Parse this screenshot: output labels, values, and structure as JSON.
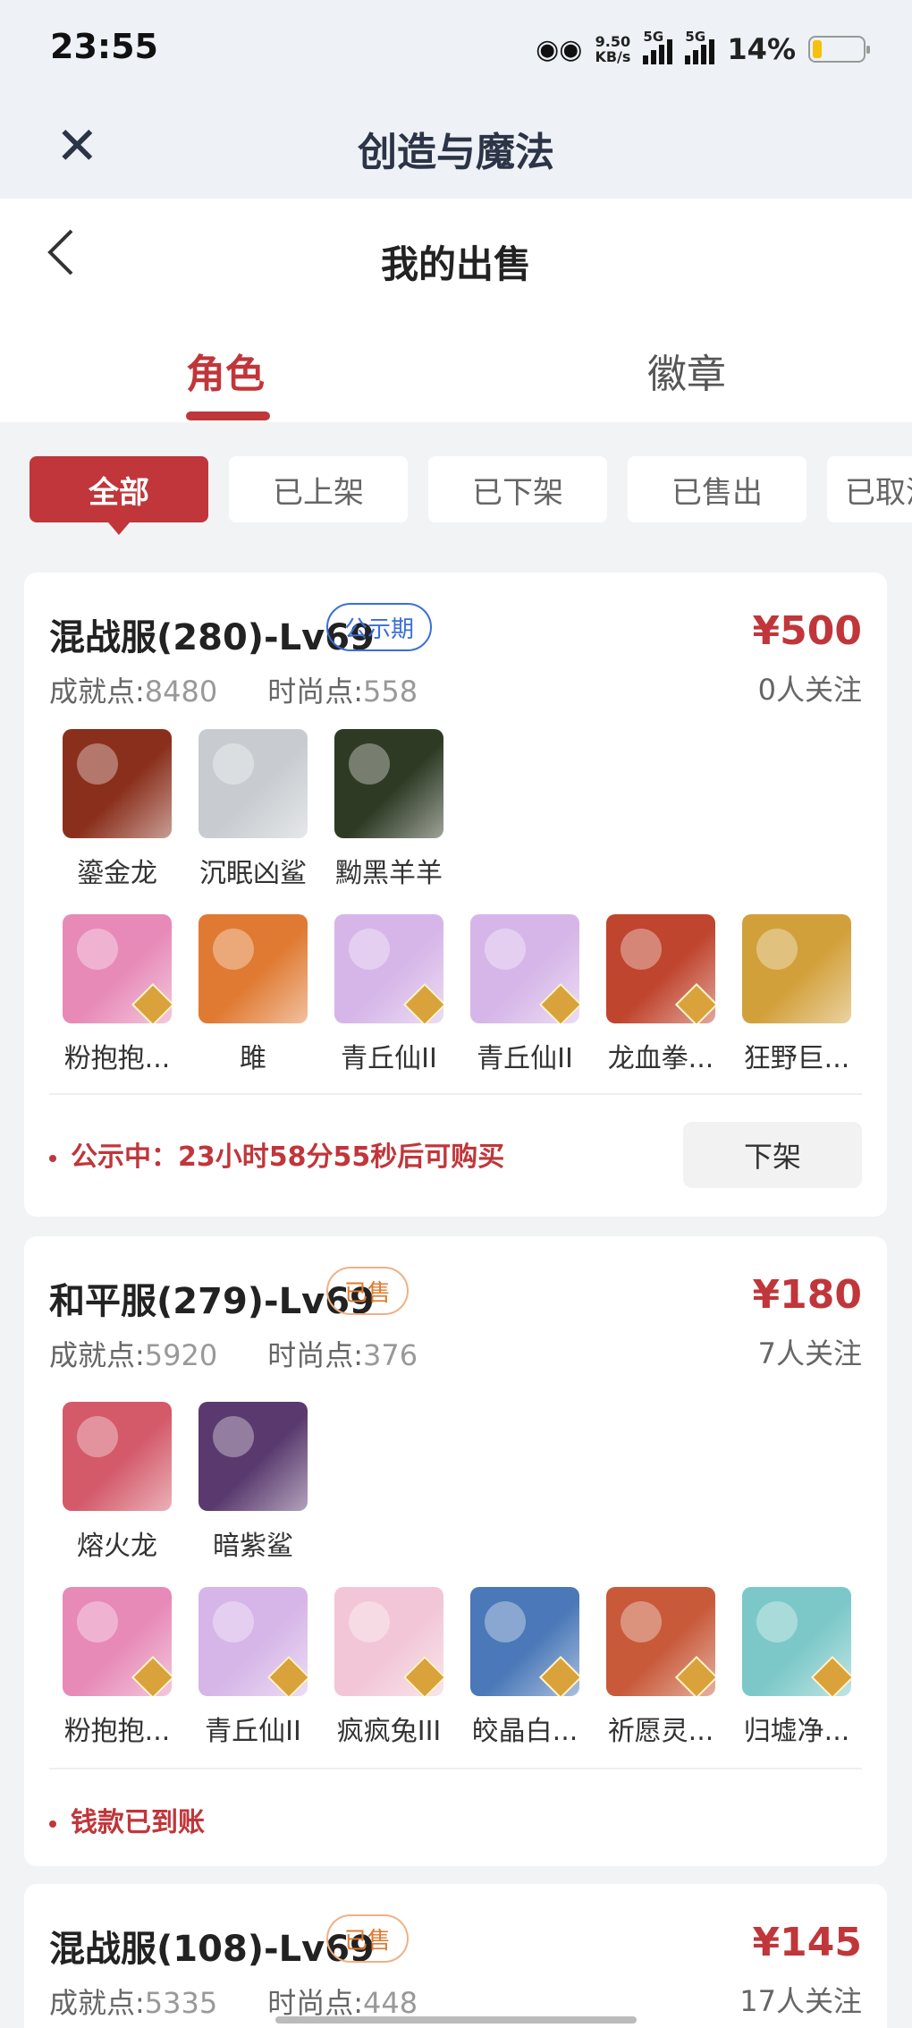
{
  "status_bar": {
    "time": "23:55",
    "net_speed_value": "9.50",
    "net_speed_unit": "KB/s",
    "sim1": "5G",
    "sim2": "5G",
    "battery": "14%"
  },
  "header": {
    "title": "创造与魔法"
  },
  "page": {
    "title": "我的出售"
  },
  "tabs": [
    {
      "label": "角色",
      "active": true
    },
    {
      "label": "徽章",
      "active": false
    }
  ],
  "filters": [
    {
      "label": "全部",
      "active": true
    },
    {
      "label": "已上架"
    },
    {
      "label": "已下架"
    },
    {
      "label": "已售出"
    },
    {
      "label": "已取消"
    }
  ],
  "colors": {
    "accent": "#c0363a",
    "public_badge": "#3a6ed8",
    "sold_badge": "#e07a2e"
  },
  "listings": [
    {
      "title": "混战服(280)-Lv69",
      "badge": "公示期",
      "price": "¥500",
      "achievement_label": "成就点:",
      "achievement": "8480",
      "fashion_label": "时尚点:",
      "fashion": "558",
      "followers": "0人关注",
      "mounts": [
        {
          "name": "鎏金龙",
          "color": "#8a2f1c"
        },
        {
          "name": "沉眠凶鲨",
          "color": "#c8ccd0"
        },
        {
          "name": "黝黑羊羊",
          "color": "#2e3a24"
        }
      ],
      "pets": [
        {
          "name": "粉抱抱...",
          "color": "#e78ab8"
        },
        {
          "name": "雎",
          "color": "#e07a32"
        },
        {
          "name": "青丘仙II",
          "color": "#d6b6e8"
        },
        {
          "name": "青丘仙II",
          "color": "#d6b6e8"
        },
        {
          "name": "龙血拳...",
          "color": "#c0452e"
        },
        {
          "name": "狂野巨...",
          "color": "#d2a03a"
        }
      ],
      "status": "公示中：23小时58分55秒后可购买",
      "action": "下架"
    },
    {
      "title": "和平服(279)-Lv69",
      "badge": "已售",
      "price": "¥180",
      "achievement_label": "成就点:",
      "achievement": "5920",
      "fashion_label": "时尚点:",
      "fashion": "376",
      "followers": "7人关注",
      "mounts": [
        {
          "name": "熔火龙",
          "color": "#d45a6a"
        },
        {
          "name": "暗紫鲨",
          "color": "#5a3a6e"
        }
      ],
      "pets": [
        {
          "name": "粉抱抱...",
          "color": "#e78ab8"
        },
        {
          "name": "青丘仙II",
          "color": "#d6b6e8"
        },
        {
          "name": "疯疯兔III",
          "color": "#f2c6d6"
        },
        {
          "name": "皎晶白...",
          "color": "#4a78b8"
        },
        {
          "name": "祈愿灵...",
          "color": "#c85a3a"
        },
        {
          "name": "归墟净...",
          "color": "#7cc8c8"
        }
      ],
      "status": "钱款已到账"
    },
    {
      "title": "混战服(108)-Lv69",
      "badge": "已售",
      "price": "¥145",
      "achievement_label": "成就点:",
      "achievement": "5335",
      "fashion_label": "时尚点:",
      "fashion": "448",
      "followers": "17人关注"
    }
  ]
}
